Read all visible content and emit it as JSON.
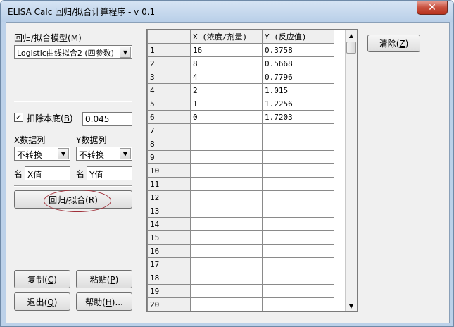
{
  "window": {
    "title": "ELISA Calc 回归/拟合计算程序 - v 0.1",
    "close_glyph": "✕"
  },
  "left": {
    "model_label": "回归/拟合模型(M)",
    "model_label_pre": "回归/拟合模型(",
    "model_label_key": "M",
    "model_label_post": ")",
    "model_value": "Logistic曲线拟合2 (四参数)",
    "subtract_background": {
      "label_pre": "扣除本底(",
      "label_key": "B",
      "label_post": ")",
      "checked": true,
      "check_glyph": "✓",
      "value": "0.045"
    },
    "x_column": {
      "label_key": "X",
      "label_rest": "数据列",
      "transform": "不转换"
    },
    "y_column": {
      "label_key": "Y",
      "label_rest": "数据列",
      "transform": "不转换"
    },
    "x_name": {
      "label": "名",
      "value": "X值"
    },
    "y_name": {
      "label": "名",
      "value": "Y值"
    },
    "fit_button": {
      "pre": "回归/拟合(",
      "key": "R",
      "post": ")"
    },
    "copy_button": {
      "pre": "复制(",
      "key": "C",
      "post": ")"
    },
    "paste_button": {
      "pre": "粘贴(",
      "key": "P",
      "post": ")"
    },
    "exit_button": {
      "pre": "退出(",
      "key": "Q",
      "post": ")"
    },
    "help_button": {
      "pre": "帮助(",
      "key": "H",
      "post": ")..."
    }
  },
  "clear_button": {
    "pre": "清除(",
    "key": "Z",
    "post": ")"
  },
  "grid": {
    "headers": [
      "",
      "X (浓度/剂量)",
      "Y (反应值)"
    ],
    "rows": [
      [
        "1",
        "16",
        "0.3758"
      ],
      [
        "2",
        "8",
        "0.5668"
      ],
      [
        "3",
        "4",
        "0.7796"
      ],
      [
        "4",
        "2",
        "1.015"
      ],
      [
        "5",
        "1",
        "1.2256"
      ],
      [
        "6",
        "0",
        "1.7203"
      ],
      [
        "7",
        "",
        ""
      ],
      [
        "8",
        "",
        ""
      ],
      [
        "9",
        "",
        ""
      ],
      [
        "10",
        "",
        ""
      ],
      [
        "11",
        "",
        ""
      ],
      [
        "12",
        "",
        ""
      ],
      [
        "13",
        "",
        ""
      ],
      [
        "14",
        "",
        ""
      ],
      [
        "15",
        "",
        ""
      ],
      [
        "16",
        "",
        ""
      ],
      [
        "17",
        "",
        ""
      ],
      [
        "18",
        "",
        ""
      ],
      [
        "19",
        "",
        ""
      ],
      [
        "20",
        "",
        ""
      ]
    ]
  },
  "icons": {
    "dropdown": "▼",
    "scroll_up": "▲",
    "scroll_down": "▼"
  }
}
